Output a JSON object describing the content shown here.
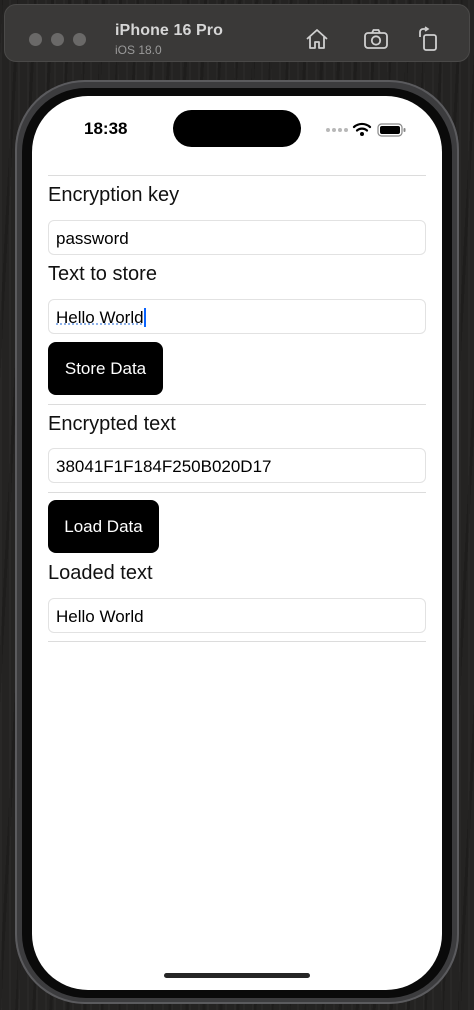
{
  "simulator": {
    "device_name": "iPhone 16 Pro",
    "os_version": "iOS 18.0",
    "toolbar_icons": [
      "home-icon",
      "screenshot-icon",
      "rotate-icon"
    ]
  },
  "status_bar": {
    "time": "18:38",
    "icons": [
      "signal-dots-icon",
      "wifi-icon",
      "battery-icon"
    ]
  },
  "form": {
    "key_label": "Encryption key",
    "key_value": "password",
    "text_label": "Text to store",
    "text_value": "Hello World",
    "store_button": "Store Data",
    "encrypted_label": "Encrypted text",
    "encrypted_value": "38041F1F184F250B020D17",
    "load_button": "Load Data",
    "loaded_label": "Loaded text",
    "loaded_value": "Hello World"
  },
  "colors": {
    "button_bg": "#000000",
    "button_text": "#ffffff",
    "caret": "#0a64ff"
  }
}
